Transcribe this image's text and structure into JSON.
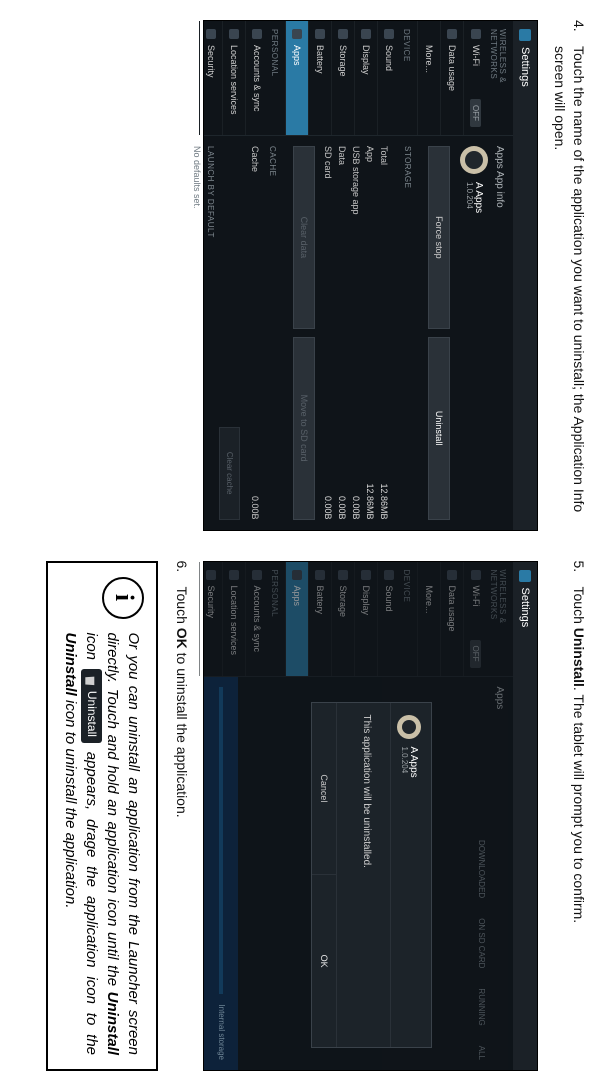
{
  "steps": {
    "s4_num": "4.",
    "s4_text_a": "Touch the name of the application you want to uninstall; the Application Info screen will open.",
    "s5_num": "5.",
    "s5_text_a": "Touch ",
    "s5_bold": "Uninstall",
    "s5_text_b": ". The tablet will prompt you to confirm.",
    "s6_num": "6.",
    "s6_text_a": "Touch ",
    "s6_bold": "OK",
    "s6_text_b": " to uninstall the application."
  },
  "callout": {
    "t1": "Or you can uninstall an application from the Launcher screen directly. Touch and hold an ap­plication icon until the ",
    "b1": "Uninstall",
    "t2": " icon ",
    "chip": "Uninstall",
    "t3": " appears, drage the application icon to the ",
    "b2": "Unin­stall",
    "t4": " icon to uninstall the application."
  },
  "android": {
    "settings_title": "Settings",
    "wifi_off": "OFF",
    "cat_wn": "WIRELESS & NETWORKS",
    "cat_dev": "DEVICE",
    "cat_pers": "PERSONAL",
    "sb": {
      "wifi": "Wi-Fi",
      "data": "Data usage",
      "more": "More...",
      "sound": "Sound",
      "display": "Display",
      "storage": "Storage",
      "battery": "Battery",
      "apps": "Apps",
      "accounts": "Accounts & sync",
      "location": "Location services",
      "security": "Security"
    },
    "left": {
      "crumb": "Apps   App info",
      "app_name": "A Apps",
      "app_ver": "1.0.204",
      "btn_force": "Force stop",
      "btn_uninstall": "Uninstall",
      "sect_storage": "STORAGE",
      "total_l": "Total",
      "total_v": "12.86MB",
      "app_l": "App",
      "app_v": "12.86MB",
      "usb_l": "USB storage app",
      "usb_v": "0.00B",
      "data_l": "Data",
      "data_v": "0.00B",
      "sd_l": "SD card",
      "sd_v": "0.00B",
      "btn_cleardata": "Clear data",
      "btn_move": "Move to SD card",
      "sect_cache": "CACHE",
      "cache_l": "Cache",
      "cache_v": "0.00B",
      "btn_clearcache": "Clear cache",
      "launch_lbl": "LAUNCH BY DEFAULT",
      "no_defaults": "No defaults set."
    },
    "right": {
      "crumb": "Apps",
      "tab_down": "DOWNLOADED",
      "tab_sd": "ON SD CARD",
      "tab_run": "RUNNING",
      "tab_all": "ALL",
      "dlg_title": "A Apps",
      "dlg_sub": "1.0.204",
      "dlg_msg": "This application will be uninstalled.",
      "dlg_cancel": "Cancel",
      "dlg_ok": "OK",
      "footer": "Internal storage"
    }
  }
}
